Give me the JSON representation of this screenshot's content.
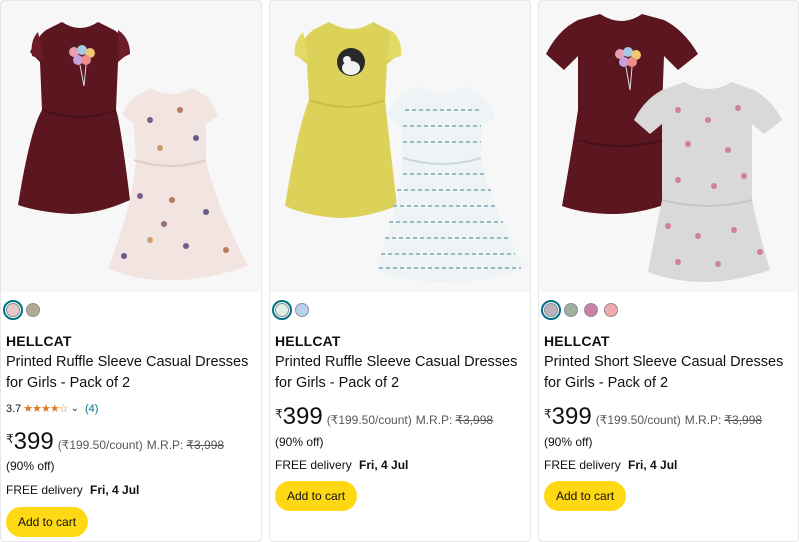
{
  "colors": {
    "accent_button": "#ffd814",
    "link": "#007185",
    "star": "#de7921"
  },
  "products": [
    {
      "image_alt_icons": [
        "maroon-ruffle-dress",
        "floral-pink-dress"
      ],
      "swatches": [
        "#e8c9c9",
        "#b3a994"
      ],
      "brand": "HELLCAT",
      "title": "Printed Ruffle Sleeve Casual Dresses for Girls - Pack of 2",
      "rating_value": "3.7",
      "stars": "★★★★☆",
      "rating_count": "(4)",
      "currency": "₹",
      "price": "399",
      "unit_price": "(₹199.50/count)",
      "mrp_label": "M.R.P:",
      "mrp": "₹3,998",
      "discount": "(90% off)",
      "delivery_label": "FREE delivery",
      "delivery_date": "Fri, 4 Jul",
      "cart_label": "Add to cart"
    },
    {
      "image_alt_icons": [
        "yellow-ruffle-dress",
        "striped-white-dress"
      ],
      "swatches": [
        "#dfeee6",
        "#b8d2ee"
      ],
      "brand": "HELLCAT",
      "title": "Printed Ruffle Sleeve Casual Dresses for Girls - Pack of 2",
      "currency": "₹",
      "price": "399",
      "unit_price": "(₹199.50/count)",
      "mrp_label": "M.R.P:",
      "mrp": "₹3,998",
      "discount": "(90% off)",
      "delivery_label": "FREE delivery",
      "delivery_date": "Fri, 4 Jul",
      "cart_label": "Add to cart"
    },
    {
      "image_alt_icons": [
        "maroon-short-sleeve-dress",
        "grey-floral-dress"
      ],
      "swatches": [
        "#bab3bc",
        "#9fb09f",
        "#c97fa6",
        "#f1a8ae"
      ],
      "brand": "HELLCAT",
      "title": "Printed Short Sleeve Casual Dresses for Girls - Pack of 2",
      "currency": "₹",
      "price": "399",
      "unit_price": "(₹199.50/count)",
      "mrp_label": "M.R.P:",
      "mrp": "₹3,998",
      "discount": "(90% off)",
      "delivery_label": "FREE delivery",
      "delivery_date": "Fri, 4 Jul",
      "cart_label": "Add to cart"
    }
  ]
}
